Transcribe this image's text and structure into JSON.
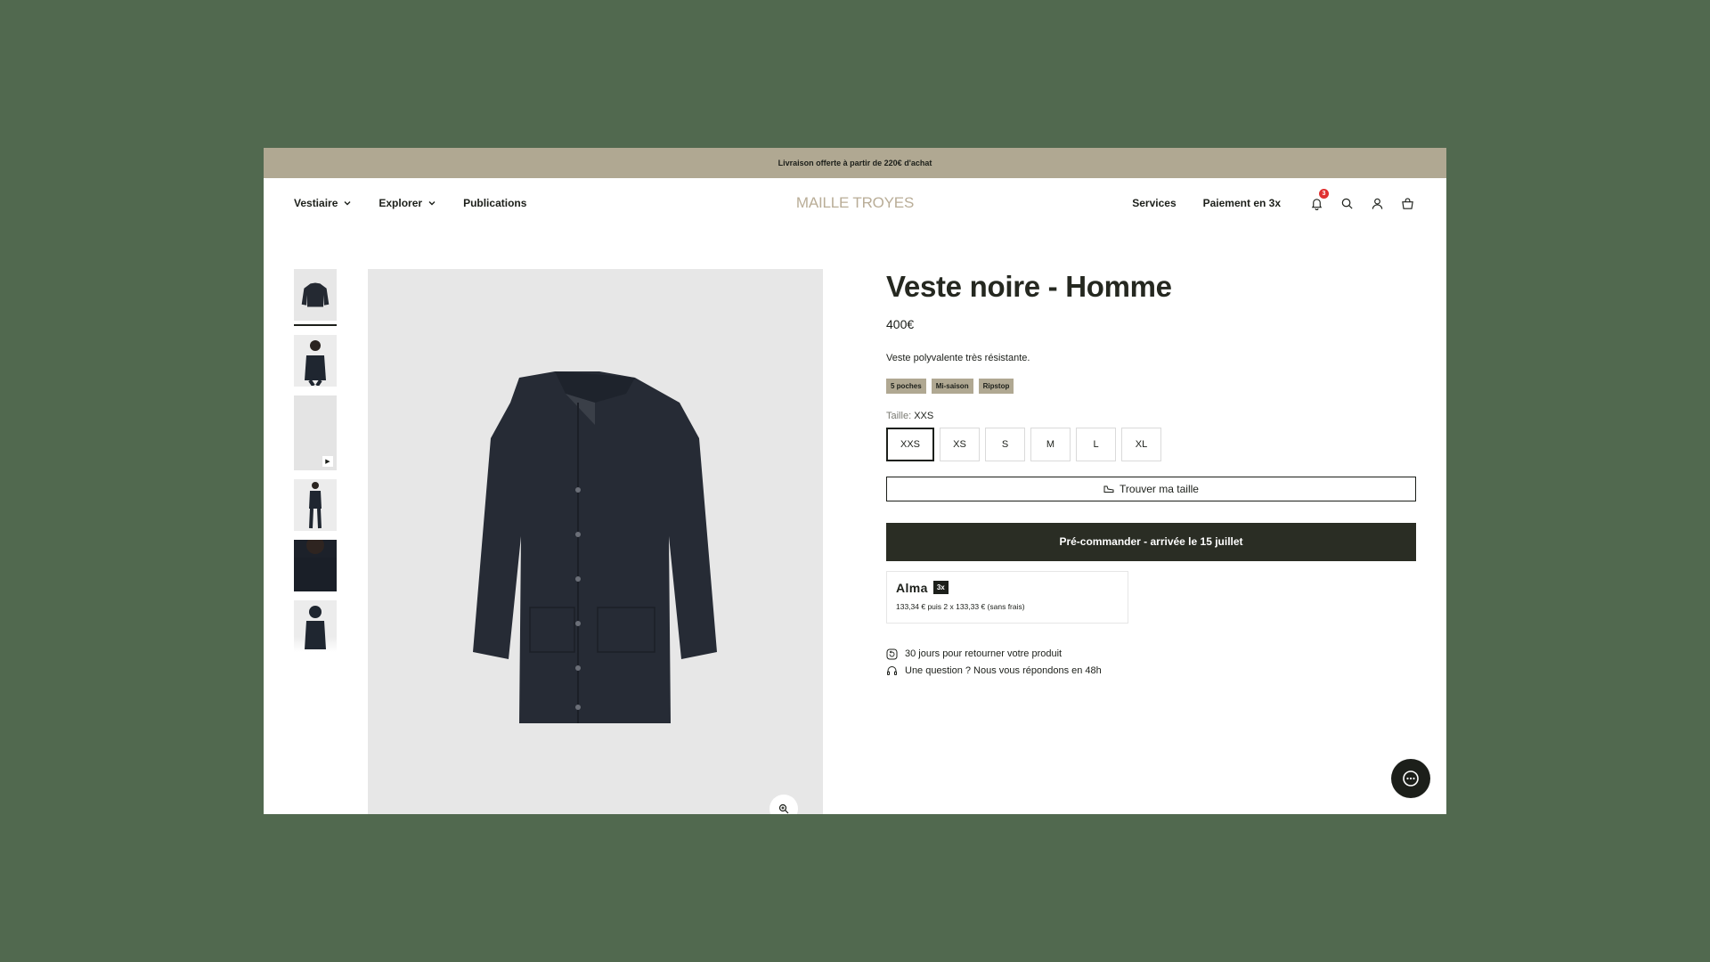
{
  "announcement": "Livraison offerte à partir de 220€ d'achat",
  "header": {
    "nav_left": [
      {
        "label": "Vestiaire",
        "dropdown": true
      },
      {
        "label": "Explorer",
        "dropdown": true
      },
      {
        "label": "Publications",
        "dropdown": false
      }
    ],
    "logo": "MAILLE TROYES",
    "nav_right": [
      "Services",
      "Paiement en 3x"
    ],
    "notification_count": "3",
    "icons": [
      "bell-icon",
      "search-icon",
      "account-icon",
      "cart-icon"
    ]
  },
  "gallery": {
    "thumbnails": [
      "jacket-flat",
      "model-front",
      "video",
      "model-full",
      "model-detail",
      "model-back"
    ],
    "active_index": 0
  },
  "product": {
    "title": "Veste noire - Homme",
    "price": "400€",
    "description": "Veste polyvalente très résistante.",
    "tags": [
      "5 poches",
      "Mi-saison",
      "Ripstop"
    ],
    "size_label": "Taille:",
    "selected_size": "XXS",
    "sizes": [
      "XXS",
      "XS",
      "S",
      "M",
      "L",
      "XL"
    ],
    "find_size_label": "Trouver ma taille",
    "cta_label": "Pré-commander - arrivée le 15 juillet"
  },
  "alma": {
    "logo": "Alma",
    "badge": "3x",
    "text": "133,34 € puis 2 x 133,33 € (sans frais)"
  },
  "perks": [
    "30 jours pour retourner votre produit",
    "Une question ? Nous vous répondons en 48h"
  ],
  "colors": {
    "background": "#51694f",
    "announcement_bar": "#b0a892",
    "tag": "#b0a892",
    "cta": "#2a2d24",
    "logo": "#b9ad97",
    "badge": "#e03030"
  }
}
